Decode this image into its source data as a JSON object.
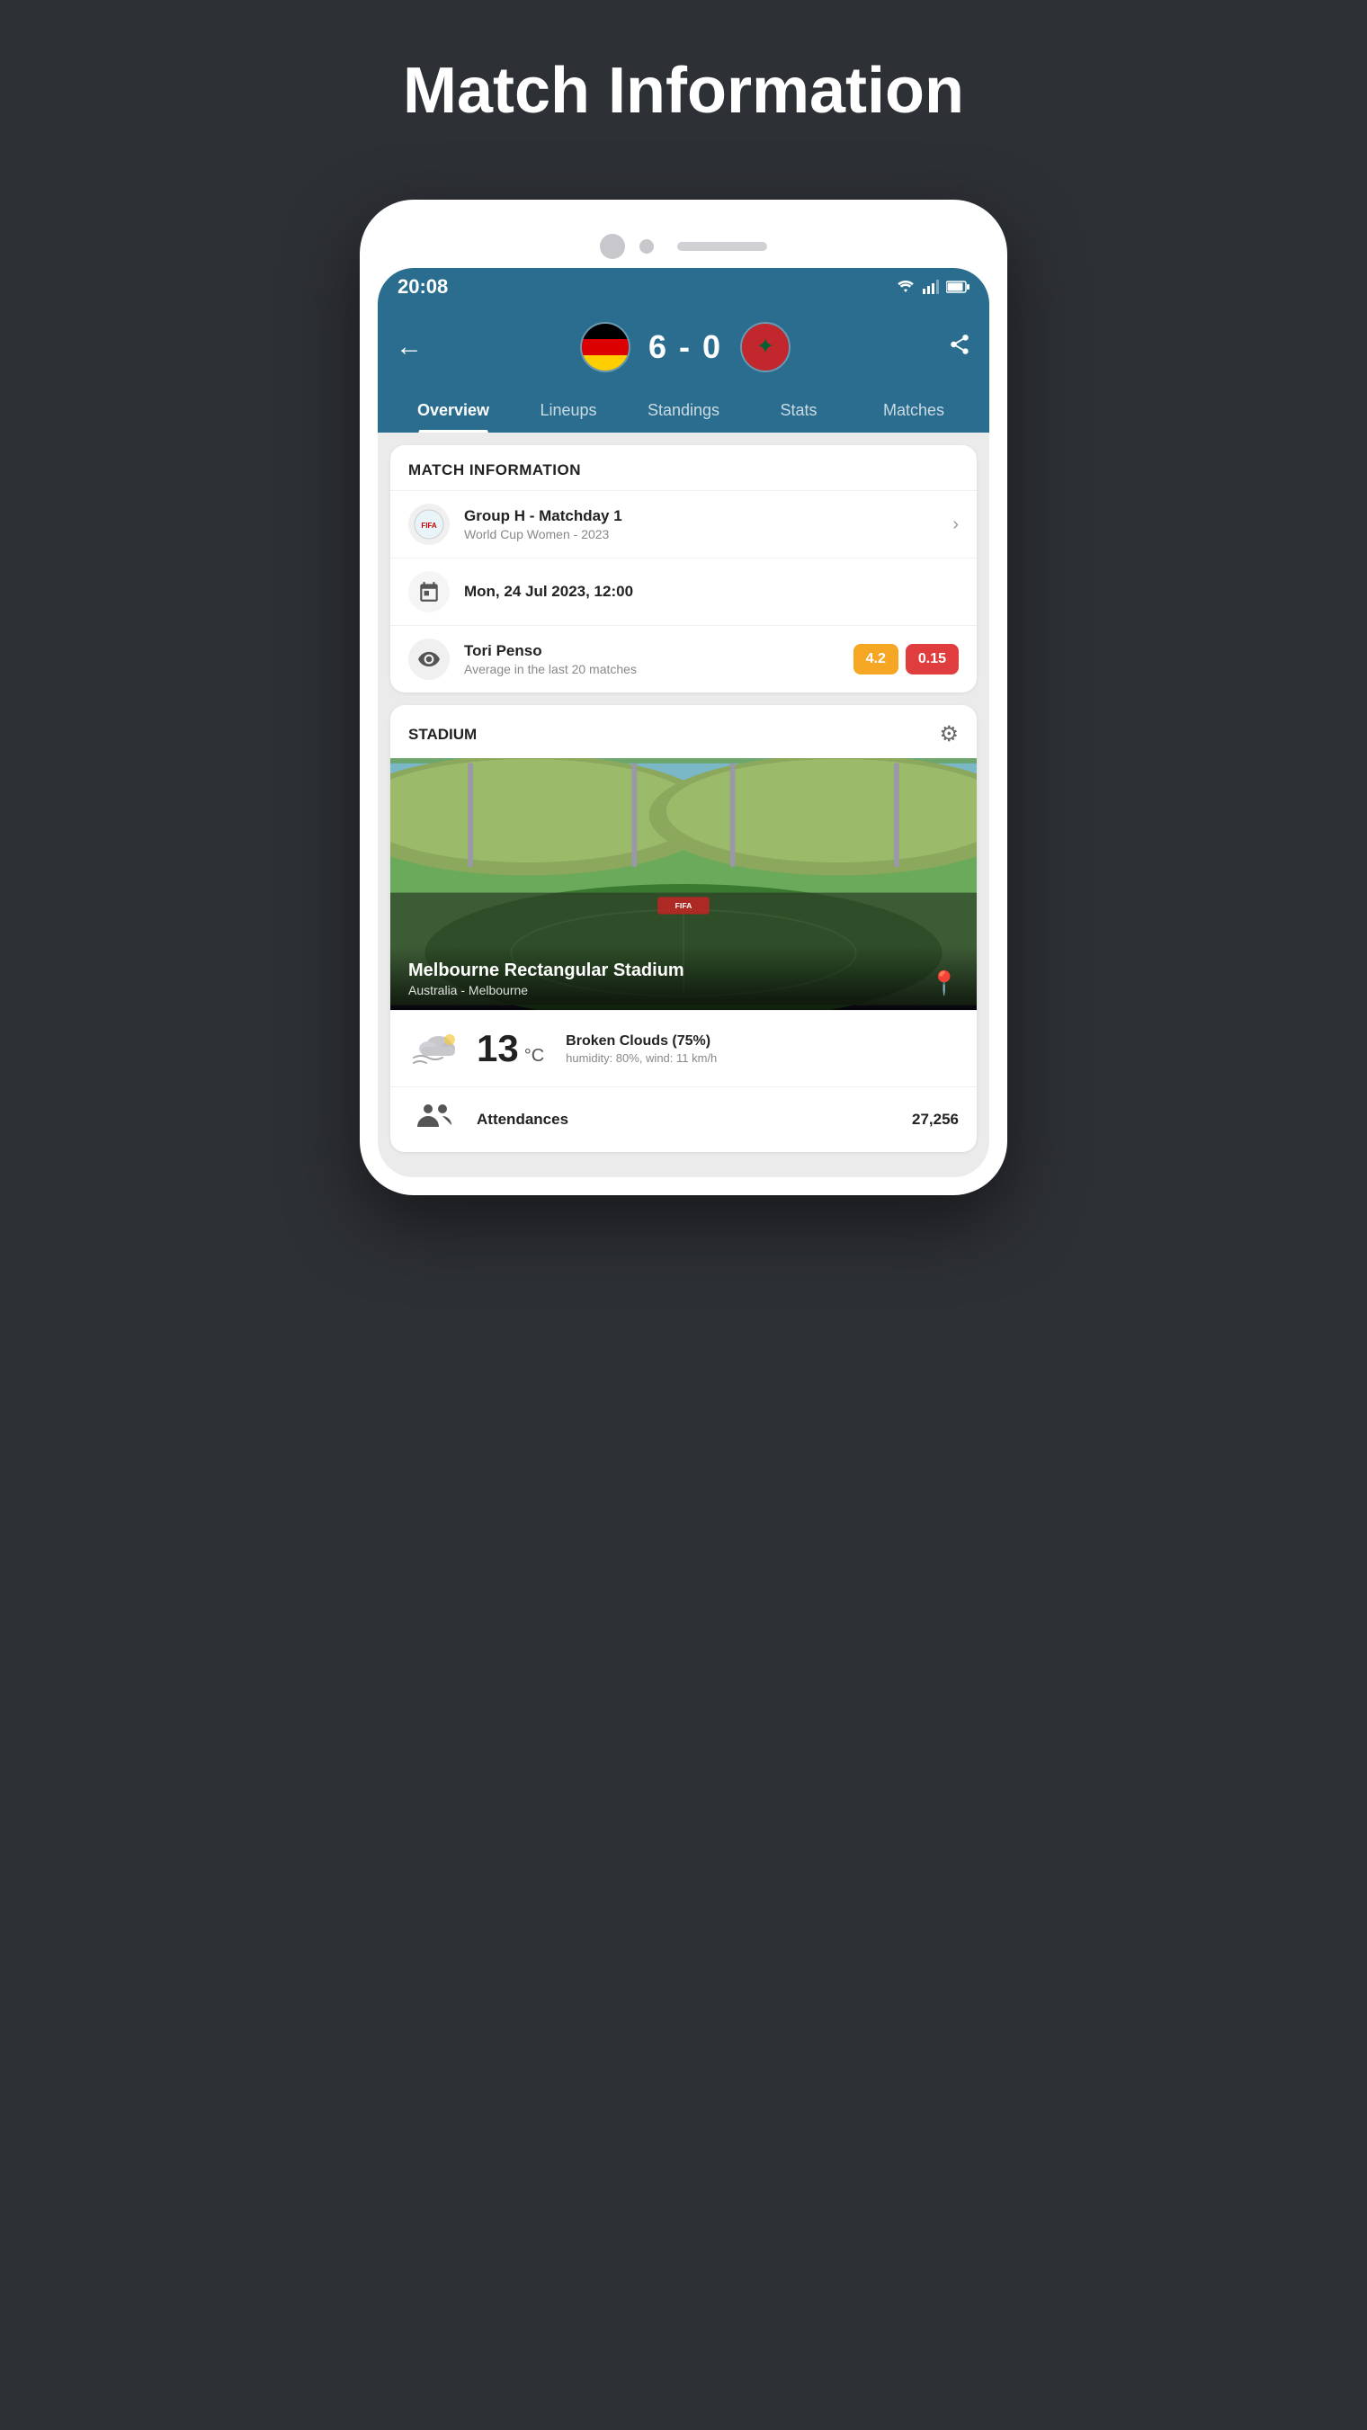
{
  "page": {
    "title": "Match Information"
  },
  "status_bar": {
    "time": "20:08"
  },
  "header": {
    "score_home": "6",
    "score_separator": "-",
    "score_away": "0",
    "score_full": "6 - 0"
  },
  "tabs": [
    {
      "label": "Overview",
      "active": true
    },
    {
      "label": "Lineups",
      "active": false
    },
    {
      "label": "Standings",
      "active": false
    },
    {
      "label": "Stats",
      "active": false
    },
    {
      "label": "Matches",
      "active": false
    }
  ],
  "match_info_section": {
    "header": "MATCH INFORMATION",
    "competition_name": "Group H - Matchday 1",
    "competition_sub": "World Cup Women - 2023",
    "date": "Mon, 24 Jul 2023, 12:00",
    "referee_name": "Tori Penso",
    "referee_sub": "Average in the last 20 matches",
    "referee_badge1": "4.2",
    "referee_badge2": "0.15"
  },
  "stadium_section": {
    "header": "STADIUM",
    "name": "Melbourne Rectangular Stadium",
    "location": "Australia - Melbourne"
  },
  "weather": {
    "temp": "13",
    "unit": "°C",
    "description": "Broken Clouds (75%)",
    "details": "humidity: 80%, wind: 11 km/h"
  },
  "attendance": {
    "label": "Attendances",
    "value": "27,256"
  }
}
